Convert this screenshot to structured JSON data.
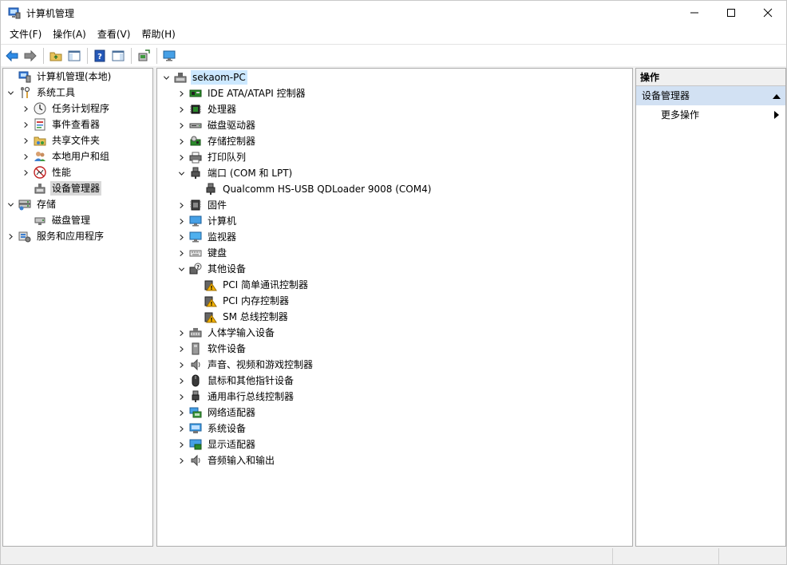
{
  "window": {
    "title": "计算机管理",
    "controls": [
      "minimize-icon",
      "maximize-icon",
      "close-icon"
    ]
  },
  "menu": [
    "文件(F)",
    "操作(A)",
    "查看(V)",
    "帮助(H)"
  ],
  "toolbar": [
    "back-arrow-icon",
    "forward-arrow-icon",
    "up-folder-icon",
    "show-hide-tree-icon",
    "help-icon",
    "show-action-pane-icon",
    "scan-hardware-icon",
    "monitor-properties-icon"
  ],
  "left_tree": [
    {
      "label": "计算机管理(本地)",
      "icon": "computer-management-icon",
      "depth": 0,
      "chevron": "none"
    },
    {
      "label": "系统工具",
      "icon": "tools-icon",
      "depth": 0,
      "chevron": "down"
    },
    {
      "label": "任务计划程序",
      "icon": "clock-icon",
      "depth": 1,
      "chevron": "right"
    },
    {
      "label": "事件查看器",
      "icon": "event-viewer-icon",
      "depth": 1,
      "chevron": "right"
    },
    {
      "label": "共享文件夹",
      "icon": "shared-folder-icon",
      "depth": 1,
      "chevron": "right"
    },
    {
      "label": "本地用户和组",
      "icon": "users-icon",
      "depth": 1,
      "chevron": "right"
    },
    {
      "label": "性能",
      "icon": "performance-icon",
      "depth": 1,
      "chevron": "right"
    },
    {
      "label": "设备管理器",
      "icon": "device-manager-icon",
      "depth": 1,
      "chevron": "none",
      "selected": true
    },
    {
      "label": "存储",
      "icon": "storage-icon",
      "depth": 0,
      "chevron": "down"
    },
    {
      "label": "磁盘管理",
      "icon": "disk-management-icon",
      "depth": 1,
      "chevron": "none"
    },
    {
      "label": "服务和应用程序",
      "icon": "services-icon",
      "depth": 0,
      "chevron": "right"
    }
  ],
  "device_tree": [
    {
      "label": "sekaom-PC",
      "icon": "pc-root-icon",
      "depth": 0,
      "chevron": "down",
      "selected": true
    },
    {
      "label": "IDE ATA/ATAPI 控制器",
      "icon": "ide-controller-icon",
      "depth": 1,
      "chevron": "right"
    },
    {
      "label": "处理器",
      "icon": "processor-icon",
      "depth": 1,
      "chevron": "right"
    },
    {
      "label": "磁盘驱动器",
      "icon": "disk-drive-icon",
      "depth": 1,
      "chevron": "right"
    },
    {
      "label": "存储控制器",
      "icon": "storage-controller-icon",
      "depth": 1,
      "chevron": "right"
    },
    {
      "label": "打印队列",
      "icon": "printer-icon",
      "depth": 1,
      "chevron": "right"
    },
    {
      "label": "端口 (COM 和 LPT)",
      "icon": "port-icon",
      "depth": 1,
      "chevron": "down"
    },
    {
      "label": "Qualcomm HS-USB QDLoader 9008 (COM4)",
      "icon": "port-icon",
      "depth": 2,
      "chevron": "none"
    },
    {
      "label": "固件",
      "icon": "firmware-icon",
      "depth": 1,
      "chevron": "right"
    },
    {
      "label": "计算机",
      "icon": "computer-icon",
      "depth": 1,
      "chevron": "right"
    },
    {
      "label": "监视器",
      "icon": "monitor-icon",
      "depth": 1,
      "chevron": "right"
    },
    {
      "label": "键盘",
      "icon": "keyboard-icon",
      "depth": 1,
      "chevron": "right"
    },
    {
      "label": "其他设备",
      "icon": "unknown-device-icon",
      "depth": 1,
      "chevron": "down"
    },
    {
      "label": "PCI 简单通讯控制器",
      "icon": "warning-device-icon",
      "depth": 2,
      "chevron": "none"
    },
    {
      "label": "PCI 内存控制器",
      "icon": "warning-device-icon",
      "depth": 2,
      "chevron": "none"
    },
    {
      "label": "SM 总线控制器",
      "icon": "warning-device-icon",
      "depth": 2,
      "chevron": "none"
    },
    {
      "label": "人体学输入设备",
      "icon": "hid-icon",
      "depth": 1,
      "chevron": "right"
    },
    {
      "label": "软件设备",
      "icon": "software-device-icon",
      "depth": 1,
      "chevron": "right"
    },
    {
      "label": "声音、视频和游戏控制器",
      "icon": "speaker-icon",
      "depth": 1,
      "chevron": "right"
    },
    {
      "label": "鼠标和其他指针设备",
      "icon": "mouse-icon",
      "depth": 1,
      "chevron": "right"
    },
    {
      "label": "通用串行总线控制器",
      "icon": "usb-icon",
      "depth": 1,
      "chevron": "right"
    },
    {
      "label": "网络适配器",
      "icon": "network-adapter-icon",
      "depth": 1,
      "chevron": "right"
    },
    {
      "label": "系统设备",
      "icon": "system-device-icon",
      "depth": 1,
      "chevron": "right"
    },
    {
      "label": "显示适配器",
      "icon": "display-adapter-icon",
      "depth": 1,
      "chevron": "right"
    },
    {
      "label": "音频输入和输出",
      "icon": "audio-io-icon",
      "depth": 1,
      "chevron": "right"
    }
  ],
  "actions": {
    "header": "操作",
    "section": "设备管理器",
    "items": [
      "更多操作"
    ]
  },
  "colors": {
    "selection_gray": "#d9d9d9",
    "selection_blue": "#cce8ff",
    "action_section": "#d2e1f3",
    "warning": "#f5b400"
  }
}
